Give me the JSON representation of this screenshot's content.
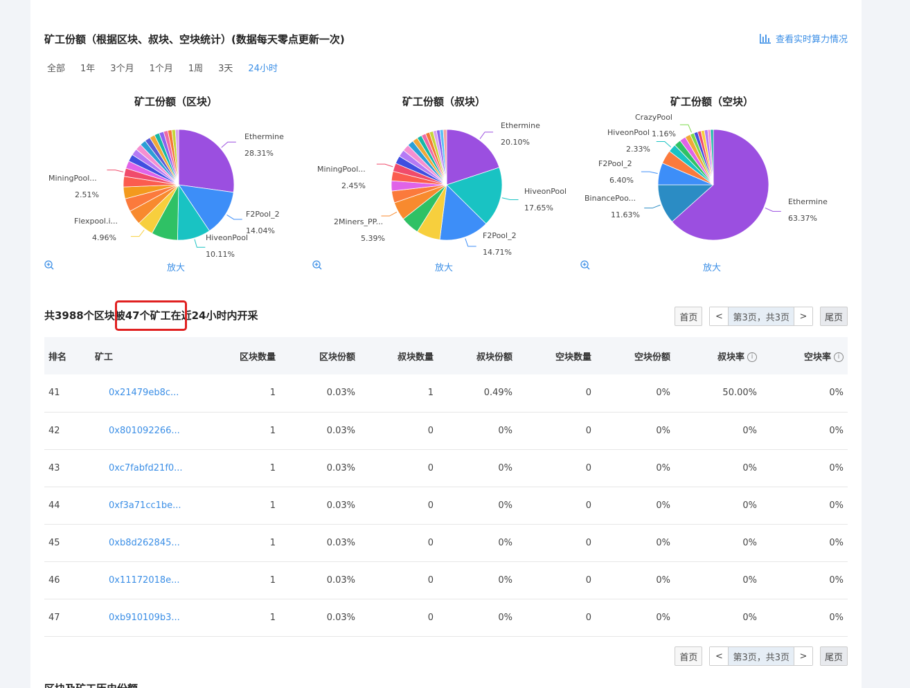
{
  "section_title": "矿工份额（根据区块、叔块、空块统计）(数据每天零点更新一次)",
  "realtime_link": "查看实时算力情况",
  "ranges": [
    "全部",
    "1年",
    "3个月",
    "1个月",
    "1周",
    "3天",
    "24小时"
  ],
  "active_range": "24小时",
  "zoom_label": "放大",
  "charts": [
    {
      "title": "矿工份额（区块）",
      "labels": [
        {
          "name": "Ethermine",
          "pct": "28.31%"
        },
        {
          "name": "F2Pool_2",
          "pct": "14.04%"
        },
        {
          "name": "HiveonPool",
          "pct": "10.11%"
        },
        {
          "name": "Flexpool.i...",
          "pct": "4.96%"
        },
        {
          "name": "MiningPool...",
          "pct": "2.51%"
        }
      ]
    },
    {
      "title": "矿工份额（叔块）",
      "labels": [
        {
          "name": "Ethermine",
          "pct": "20.10%"
        },
        {
          "name": "HiveonPool",
          "pct": "17.65%"
        },
        {
          "name": "F2Pool_2",
          "pct": "14.71%"
        },
        {
          "name": "2Miners_PP...",
          "pct": "5.39%"
        },
        {
          "name": "MiningPool...",
          "pct": "2.45%"
        }
      ]
    },
    {
      "title": "矿工份额（空块）",
      "labels": [
        {
          "name": "Ethermine",
          "pct": "63.37%"
        },
        {
          "name": "BinancePoo...",
          "pct": "11.63%"
        },
        {
          "name": "F2Pool_2",
          "pct": "6.40%"
        },
        {
          "name": "HiveonPool",
          "pct": "2.33%"
        },
        {
          "name": "CrazyPool",
          "pct": "1.16%"
        }
      ]
    }
  ],
  "chart_data": [
    {
      "type": "pie",
      "title": "矿工份额（区块）",
      "slices": [
        {
          "name": "Ethermine",
          "value": 28.31,
          "color": "#9b4fe0"
        },
        {
          "name": "F2Pool_2",
          "value": 14.04,
          "color": "#3d8ef8"
        },
        {
          "name": "HiveonPool",
          "value": 10.11,
          "color": "#19c3c3"
        },
        {
          "name": "",
          "value": 8.0,
          "color": "#2fc165"
        },
        {
          "name": "Flexpool.i...",
          "value": 4.96,
          "color": "#f7cf3d"
        },
        {
          "name": "",
          "value": 4.5,
          "color": "#f88a2e"
        },
        {
          "name": "",
          "value": 4.0,
          "color": "#fb7a3c"
        },
        {
          "name": "",
          "value": 3.6,
          "color": "#f39a1e"
        },
        {
          "name": "",
          "value": 3.2,
          "color": "#fb5c4f"
        },
        {
          "name": "MiningPool...",
          "value": 2.51,
          "color": "#f04b6b"
        },
        {
          "name": "",
          "value": 2.3,
          "color": "#e063e8"
        },
        {
          "name": "",
          "value": 2.2,
          "color": "#3f4fe0"
        },
        {
          "name": "",
          "value": 2.0,
          "color": "#b57af5"
        },
        {
          "name": "",
          "value": 1.9,
          "color": "#f58fd1"
        },
        {
          "name": "",
          "value": 1.8,
          "color": "#2b9ed6"
        },
        {
          "name": "",
          "value": 1.7,
          "color": "#5b5bd6"
        },
        {
          "name": "",
          "value": 1.6,
          "color": "#f0a838"
        },
        {
          "name": "",
          "value": 1.5,
          "color": "#17b8a6"
        },
        {
          "name": "",
          "value": 1.4,
          "color": "#8a63f0"
        },
        {
          "name": "",
          "value": 1.3,
          "color": "#ee6aa7"
        },
        {
          "name": "",
          "value": 1.2,
          "color": "#f37935"
        },
        {
          "name": "",
          "value": 1.1,
          "color": "#c6d63a"
        },
        {
          "name": "",
          "value": 1.0,
          "color": "#d8a0f0"
        }
      ]
    },
    {
      "type": "pie",
      "title": "矿工份额（叔块）",
      "slices": [
        {
          "name": "Ethermine",
          "value": 20.1,
          "color": "#9b4fe0"
        },
        {
          "name": "HiveonPool",
          "value": 17.65,
          "color": "#19c3c3"
        },
        {
          "name": "F2Pool_2",
          "value": 14.71,
          "color": "#3d8ef8"
        },
        {
          "name": "",
          "value": 7.0,
          "color": "#f7cf3d"
        },
        {
          "name": "",
          "value": 5.5,
          "color": "#2fc165"
        },
        {
          "name": "2Miners_PP...",
          "value": 5.39,
          "color": "#f88a2e"
        },
        {
          "name": "",
          "value": 3.5,
          "color": "#fb7a3c"
        },
        {
          "name": "",
          "value": 3.0,
          "color": "#e063e8"
        },
        {
          "name": "",
          "value": 2.8,
          "color": "#fb5c4f"
        },
        {
          "name": "MiningPool...",
          "value": 2.45,
          "color": "#f04b6b"
        },
        {
          "name": "",
          "value": 2.3,
          "color": "#3f4fe0"
        },
        {
          "name": "",
          "value": 2.1,
          "color": "#b57af5"
        },
        {
          "name": "",
          "value": 2.0,
          "color": "#f58fd1"
        },
        {
          "name": "",
          "value": 1.8,
          "color": "#2b9ed6"
        },
        {
          "name": "",
          "value": 1.6,
          "color": "#f0a838"
        },
        {
          "name": "",
          "value": 1.4,
          "color": "#17b8a6"
        },
        {
          "name": "",
          "value": 1.3,
          "color": "#ee6aa7"
        },
        {
          "name": "",
          "value": 1.2,
          "color": "#f37935"
        },
        {
          "name": "",
          "value": 1.1,
          "color": "#c6d63a"
        },
        {
          "name": "",
          "value": 1.0,
          "color": "#d8a0f0"
        },
        {
          "name": "",
          "value": 1.0,
          "color": "#8a63f0"
        },
        {
          "name": "",
          "value": 1.0,
          "color": "#5bc0f5"
        },
        {
          "name": "",
          "value": 1.0,
          "color": "#f5a3a3"
        }
      ]
    },
    {
      "type": "pie",
      "title": "矿工份额（空块）",
      "slices": [
        {
          "name": "Ethermine",
          "value": 63.37,
          "color": "#9b4fe0"
        },
        {
          "name": "BinancePoo...",
          "value": 11.63,
          "color": "#2b8cc4"
        },
        {
          "name": "F2Pool_2",
          "value": 6.4,
          "color": "#3d8ef8"
        },
        {
          "name": "",
          "value": 4.0,
          "color": "#fb7a3c"
        },
        {
          "name": "HiveonPool",
          "value": 2.33,
          "color": "#19c3c3"
        },
        {
          "name": "",
          "value": 2.0,
          "color": "#2fc165"
        },
        {
          "name": "",
          "value": 1.8,
          "color": "#e063e8"
        },
        {
          "name": "",
          "value": 1.6,
          "color": "#f0a838"
        },
        {
          "name": "CrazyPool",
          "value": 1.16,
          "color": "#7bd94a"
        },
        {
          "name": "",
          "value": 1.1,
          "color": "#3f4fe0"
        },
        {
          "name": "",
          "value": 1.0,
          "color": "#f04b6b"
        },
        {
          "name": "",
          "value": 1.0,
          "color": "#f7cf3d"
        },
        {
          "name": "",
          "value": 1.0,
          "color": "#b57af5"
        },
        {
          "name": "",
          "value": 0.8,
          "color": "#f58fd1"
        },
        {
          "name": "",
          "value": 0.8,
          "color": "#17b8a6"
        }
      ]
    }
  ],
  "summary": "共3988个区块被47个矿工在近24小时内开采",
  "pager": {
    "first": "首页",
    "prev": "<",
    "info": "第3页，共3页",
    "next": ">",
    "last": "尾页"
  },
  "table": {
    "headers": [
      "排名",
      "矿工",
      "区块数量",
      "区块份额",
      "叔块数量",
      "叔块份额",
      "空块数量",
      "空块份额",
      "叔块率",
      "空块率"
    ],
    "rows": [
      [
        "41",
        "0x21479eb8c...",
        "1",
        "0.03%",
        "1",
        "0.49%",
        "0",
        "0%",
        "50.00%",
        "0%"
      ],
      [
        "42",
        "0x801092266...",
        "1",
        "0.03%",
        "0",
        "0%",
        "0",
        "0%",
        "0%",
        "0%"
      ],
      [
        "43",
        "0xc7fabfd21f0...",
        "1",
        "0.03%",
        "0",
        "0%",
        "0",
        "0%",
        "0%",
        "0%"
      ],
      [
        "44",
        "0xf3a71cc1be...",
        "1",
        "0.03%",
        "0",
        "0%",
        "0",
        "0%",
        "0%",
        "0%"
      ],
      [
        "45",
        "0xb8d262845...",
        "1",
        "0.03%",
        "0",
        "0%",
        "0",
        "0%",
        "0%",
        "0%"
      ],
      [
        "46",
        "0x11172018e...",
        "1",
        "0.03%",
        "0",
        "0%",
        "0",
        "0%",
        "0%",
        "0%"
      ],
      [
        "47",
        "0xb910109b3...",
        "1",
        "0.03%",
        "0",
        "0%",
        "0",
        "0%",
        "0%",
        "0%"
      ]
    ]
  },
  "next_section_title": "区块及矿工历史份额",
  "colors": {
    "accent": "#3a8ee6",
    "highlight": "#e02020"
  }
}
